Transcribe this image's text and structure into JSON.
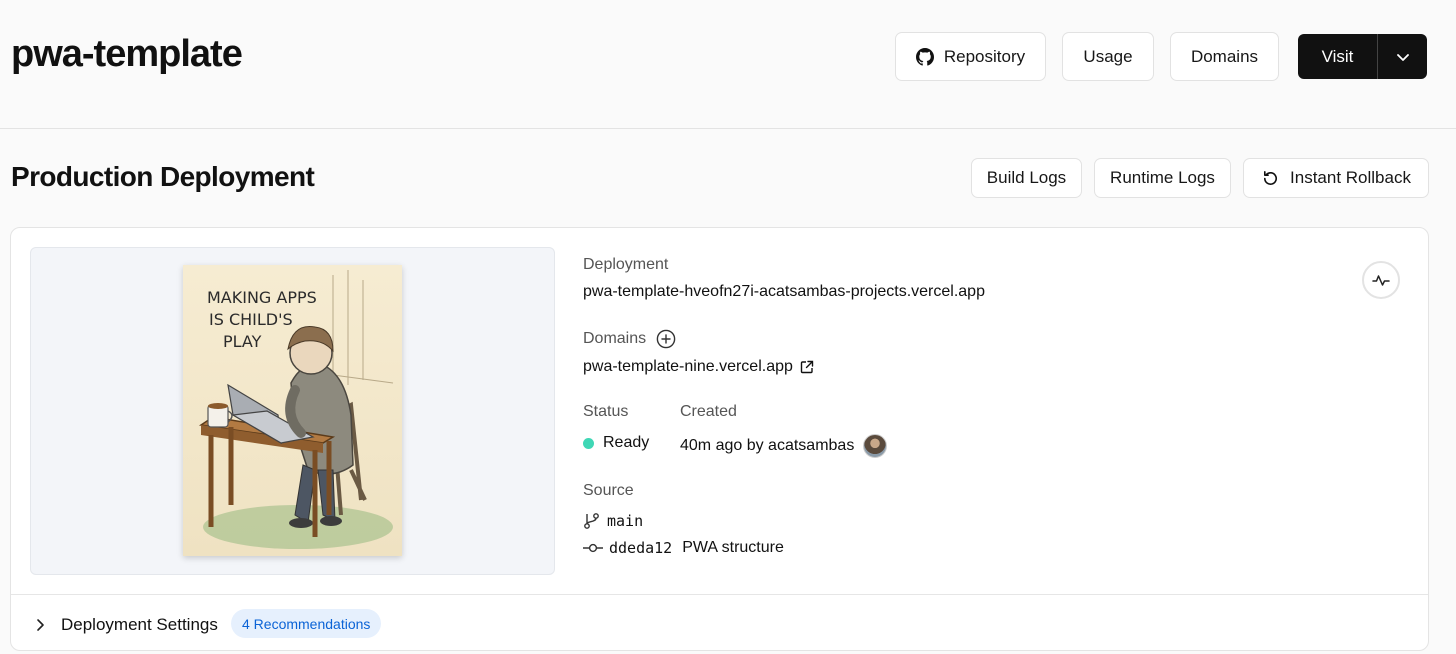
{
  "header": {
    "project_title": "pwa-template",
    "repository_label": "Repository",
    "usage_label": "Usage",
    "domains_label": "Domains",
    "visit_label": "Visit"
  },
  "production": {
    "title": "Production Deployment",
    "build_logs_label": "Build Logs",
    "runtime_logs_label": "Runtime Logs",
    "instant_rollback_label": "Instant Rollback"
  },
  "thumbnail": {
    "line1": "MAKING APPS",
    "line2": "IS CHILD'S",
    "line3": "PLAY"
  },
  "deployment": {
    "label": "Deployment",
    "url": "pwa-template-hveofn27i-acatsambas-projects.vercel.app",
    "domains_label": "Domains",
    "domain": "pwa-template-nine.vercel.app",
    "status_label": "Status",
    "status_value": "Ready",
    "status_color": "#3fd7b5",
    "created_label": "Created",
    "created_value": "40m ago by acatsambas",
    "source_label": "Source",
    "branch": "main",
    "commit_hash": "ddeda12",
    "commit_message": "PWA structure"
  },
  "footer": {
    "settings_label": "Deployment Settings",
    "recommendations_badge": "4 Recommendations"
  },
  "icons": [
    "github-icon",
    "chevron-down-icon",
    "rollback-icon",
    "activity-icon",
    "plus-circle-icon",
    "external-link-icon",
    "branch-icon",
    "commit-icon",
    "chevron-right-icon",
    "avatar"
  ]
}
